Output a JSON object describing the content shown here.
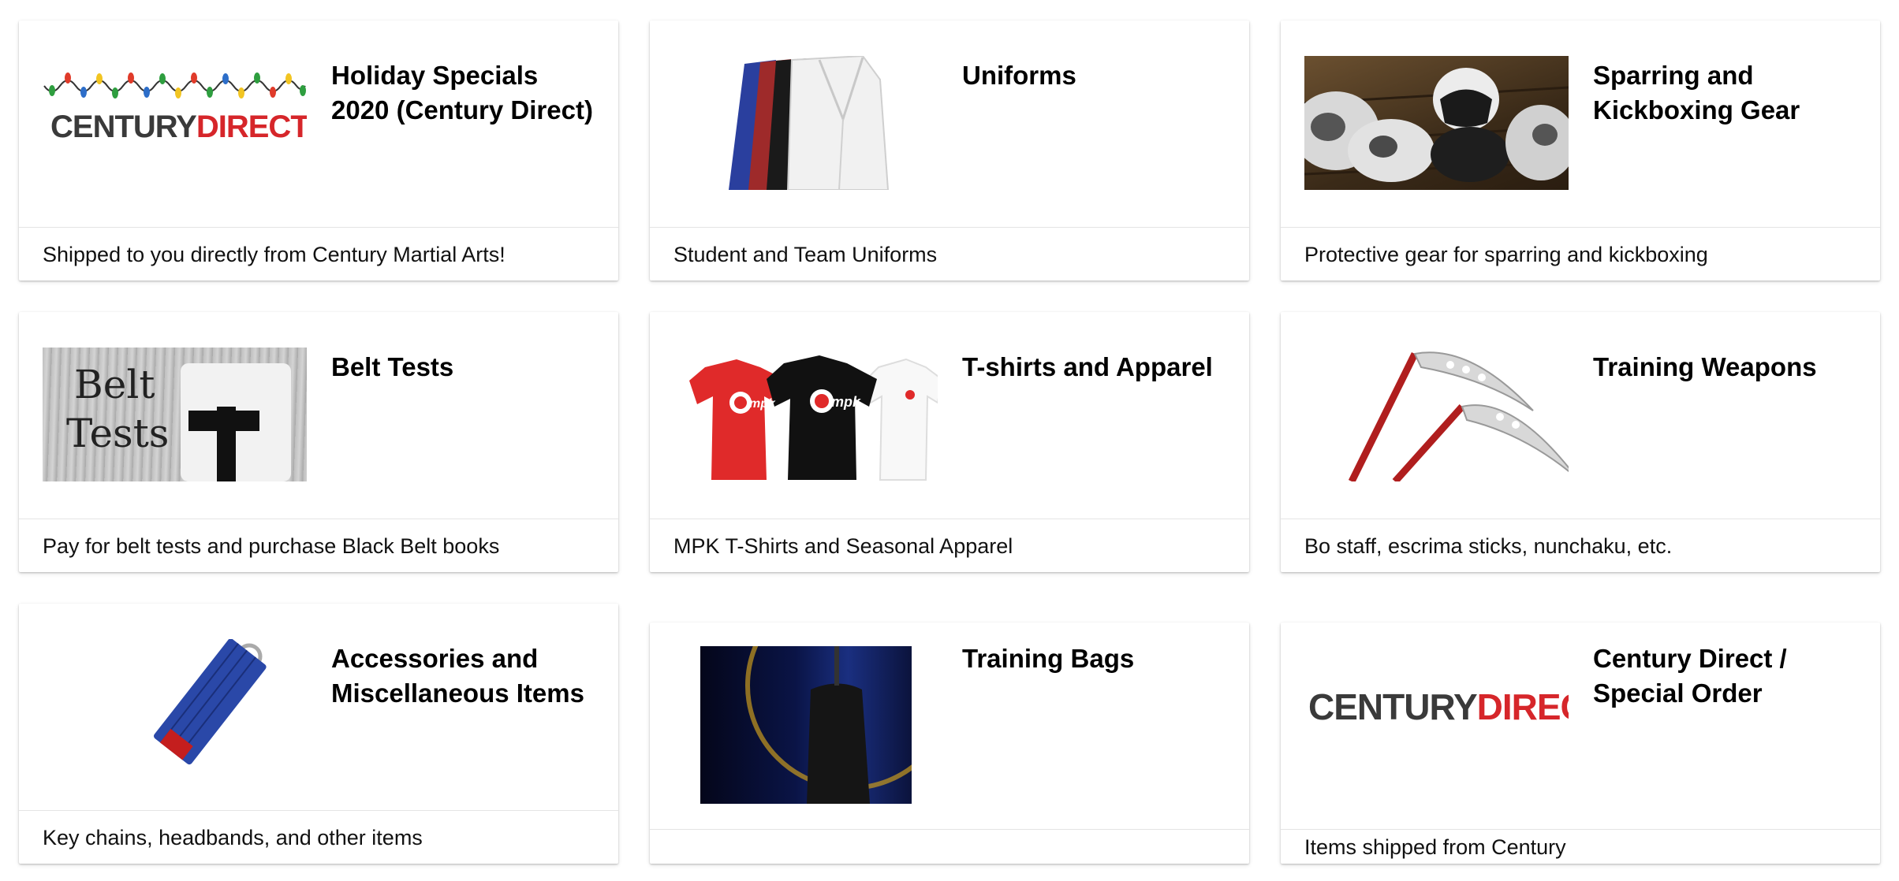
{
  "cards": [
    {
      "title": "Holiday Specials 2020 (Century Direct)",
      "description": "Shipped to you directly from Century Martial Arts!",
      "image": "century-direct-holiday-logo",
      "logo_dark": "CENTURY",
      "logo_red": "DIRECT"
    },
    {
      "title": "Uniforms",
      "description": "Student and Team Uniforms",
      "image": "uniforms-photo"
    },
    {
      "title": "Sparring and Kickboxing Gear",
      "description": "Protective gear for sparring and kickboxing",
      "image": "sparring-gear-photo"
    },
    {
      "title": "Belt Tests",
      "description": "Pay for belt tests and purchase Black Belt books",
      "image": "belt-tests-photo",
      "image_text_1": "Belt",
      "image_text_2": "Tests"
    },
    {
      "title": "T-shirts and Apparel",
      "description": "MPK T-Shirts and Seasonal Apparel",
      "image": "tshirts-photo",
      "shirt_logo": "mpk"
    },
    {
      "title": "Training Weapons",
      "description": "Bo staff, escrima sticks, nunchaku, etc.",
      "image": "kama-weapons-photo"
    },
    {
      "title": "Accessories and Miscellaneous Items",
      "description": "Key chains, headbands, and other items",
      "image": "keychain-photo"
    },
    {
      "title": "Training Bags",
      "description": "",
      "image": "training-bag-photo"
    },
    {
      "title": "Century Direct / Special Order",
      "description": "Items shipped from Century",
      "image": "century-direct-logo",
      "logo_dark": "CENTURY",
      "logo_red": "DIRECT"
    }
  ],
  "colors": {
    "brand_red": "#d6262a",
    "logo_dark": "#3a3a3a",
    "divider": "#e4e4e4"
  }
}
